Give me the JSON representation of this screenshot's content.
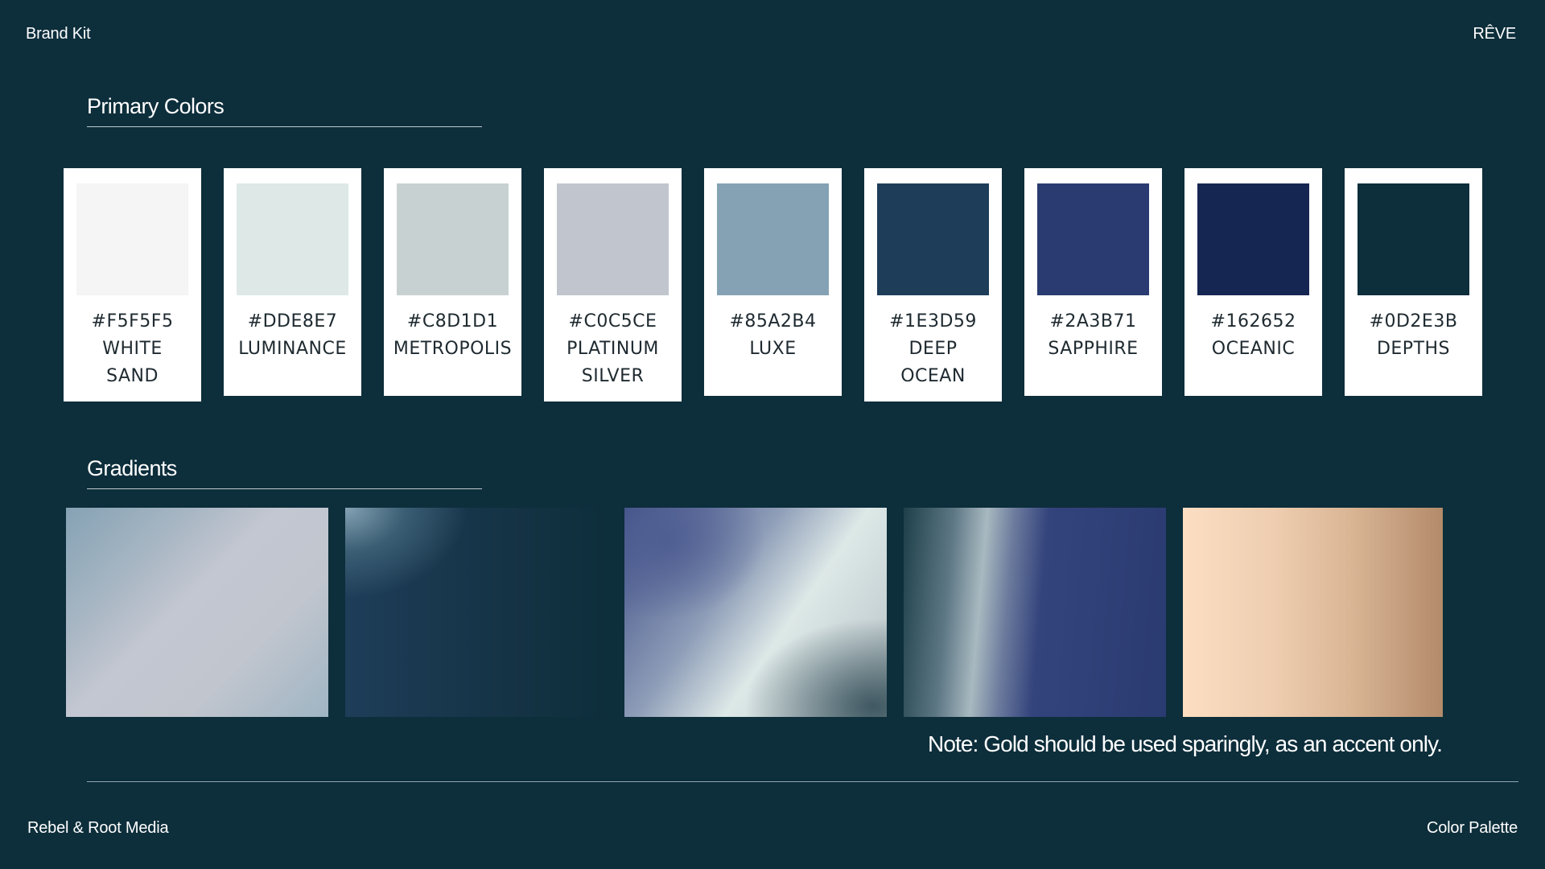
{
  "header": {
    "left": "Brand Kit",
    "right": "RÊVE"
  },
  "sections": {
    "primary_title": "Primary Colors",
    "gradients_title": "Gradients"
  },
  "swatches": [
    {
      "hex": "#F5F5F5",
      "name_lines": [
        "WHITE",
        "SAND"
      ],
      "color": "#F5F5F5"
    },
    {
      "hex": "#DDE8E7",
      "name_lines": [
        "LUMINANCE"
      ],
      "color": "#DDE8E7"
    },
    {
      "hex": "#C8D1D1",
      "name_lines": [
        "METROPOLIS"
      ],
      "color": "#C8D1D1"
    },
    {
      "hex": "#C0C5CE",
      "name_lines": [
        "PLATINUM",
        "SILVER"
      ],
      "color": "#C0C5CE"
    },
    {
      "hex": "#85A2B4",
      "name_lines": [
        "LUXE"
      ],
      "color": "#85A2B4"
    },
    {
      "hex": "#1E3D59",
      "name_lines": [
        "DEEP",
        "OCEAN"
      ],
      "color": "#1E3D59"
    },
    {
      "hex": "#2A3B71",
      "name_lines": [
        "SAPPHIRE"
      ],
      "color": "#2A3B71"
    },
    {
      "hex": "#162652",
      "name_lines": [
        "OCEANIC"
      ],
      "color": "#162652"
    },
    {
      "hex": "#0D2E3B",
      "name_lines": [
        "DEPTHS"
      ],
      "color": "#0D2E3B"
    }
  ],
  "note": "Note: Gold should be used sparingly, as an accent only.",
  "footer": {
    "left": "Rebel & Root Media",
    "right": "Color Palette"
  },
  "colors": {
    "background": "#0D2E3B",
    "card": "#FFFFFF",
    "label_text": "#1E2A30"
  }
}
